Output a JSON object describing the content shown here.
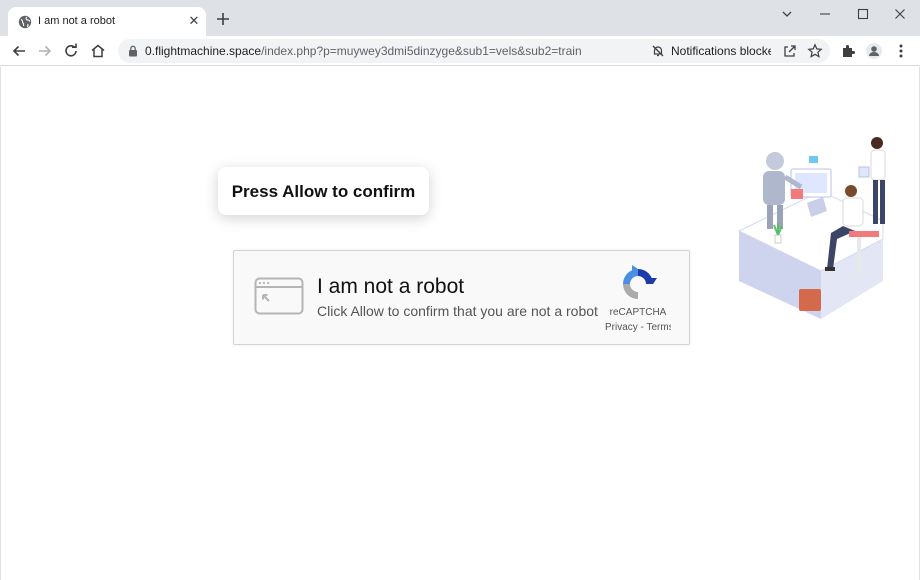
{
  "browser": {
    "tab": {
      "title": "I am not a robot"
    },
    "address": {
      "host": "0.flightmachine.space",
      "path": "/index.php?p=muywey3dmi5dinzyge&sub1=vels&sub2=train"
    },
    "notifications_status": "Notifications blocked"
  },
  "page": {
    "prompt": "Press Allow to confirm",
    "captcha": {
      "title": "I am not a robot",
      "subtitle": "Click Allow to confirm that you are not a robot",
      "brand": "reCAPTCHA",
      "links": "Privacy - Terms"
    }
  },
  "colors": {
    "tabstrip": "#dee1e6",
    "omnibox": "#f1f3f4",
    "captcha_bg": "#f9f9f9",
    "recaptcha_blue": "#1c3aa9",
    "recaptcha_light": "#4a90e2"
  }
}
